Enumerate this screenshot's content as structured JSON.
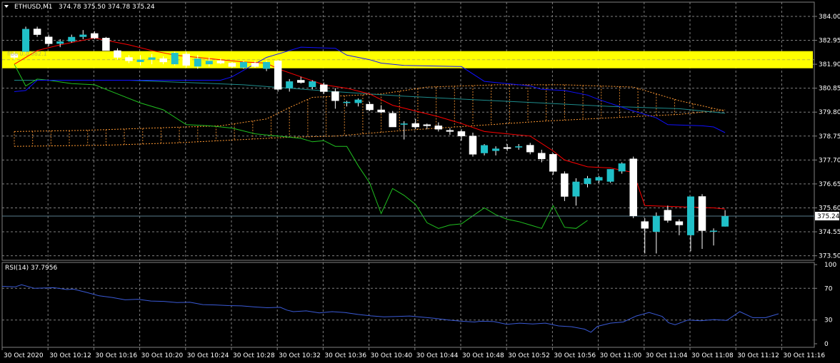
{
  "header": {
    "symbol": "ETHUSD,M1",
    "ohlc": "374.78 375.50 374.78 375.24"
  },
  "rsi_header": "RSI(14) 37.7956",
  "yellow_label": "fibo 0.0 382.1",
  "current_price_label": "375.24",
  "colors": {
    "background": "#000000",
    "grid": "#7f7f7f",
    "bull_candle": "#20c0c8",
    "bear_candle": "#ffffff",
    "fast_ma": "#ff0000",
    "kijun": "#1010ff",
    "senkou": "#ff9933",
    "chikou": "#20c020",
    "slow_ma": "#1e8c8c",
    "highlight": "#ffff00",
    "rsi_line": "#3a5ad6"
  },
  "chart_data": [
    {
      "type": "candlestick",
      "title": "ETHUSD,M1",
      "price_ticks": [
        "384.00",
        "382.95",
        "381.90",
        "380.85",
        "379.80",
        "378.75",
        "377.70",
        "376.65",
        "375.60",
        "374.55",
        "373.50"
      ],
      "time_ticks": [
        "30 Oct 2020",
        "30 Oct 10:12",
        "30 Oct 10:16",
        "30 Oct 10:20",
        "30 Oct 10:24",
        "30 Oct 10:28",
        "30 Oct 10:32",
        "30 Oct 10:36",
        "30 Oct 10:40",
        "30 Oct 10:44",
        "30 Oct 10:48",
        "30 Oct 10:52",
        "30 Oct 10:56",
        "30 Oct 11:00",
        "30 Oct 11:04",
        "30 Oct 11:08",
        "30 Oct 11:12",
        "30 Oct 11:16"
      ],
      "ylim": [
        373.3,
        384.5
      ],
      "grid": true,
      "last_price": 375.24,
      "highlight_level": 382.1,
      "candles": [
        [
          382.35,
          382.45,
          382.1,
          382.2
        ],
        [
          382.45,
          383.55,
          382.35,
          383.45
        ],
        [
          383.45,
          383.55,
          383.1,
          383.2
        ],
        [
          383.1,
          383.2,
          382.7,
          382.8
        ],
        [
          382.8,
          383.0,
          382.65,
          382.9
        ],
        [
          382.9,
          383.2,
          382.85,
          383.1
        ],
        [
          383.1,
          383.4,
          383.0,
          383.2
        ],
        [
          383.25,
          383.35,
          383.0,
          383.05
        ],
        [
          383.05,
          383.1,
          382.7,
          382.5
        ],
        [
          382.5,
          382.6,
          382.1,
          382.2
        ],
        [
          382.2,
          382.3,
          381.95,
          382.05
        ],
        [
          382.0,
          382.3,
          381.85,
          382.1
        ],
        [
          382.1,
          382.35,
          381.9,
          382.2
        ],
        [
          382.15,
          382.25,
          381.9,
          382.0
        ],
        [
          381.9,
          382.45,
          381.85,
          382.4
        ],
        [
          382.35,
          382.45,
          381.75,
          381.85
        ],
        [
          381.8,
          382.3,
          381.7,
          382.15
        ],
        [
          381.9,
          382.2,
          381.8,
          382.05
        ],
        [
          382.05,
          382.15,
          381.9,
          381.95
        ],
        [
          381.95,
          382.0,
          381.75,
          381.8
        ],
        [
          381.75,
          382.05,
          381.7,
          382.0
        ],
        [
          381.95,
          382.05,
          381.75,
          381.8
        ],
        [
          381.7,
          382.05,
          381.6,
          382.0
        ],
        [
          382.05,
          382.1,
          380.7,
          380.8
        ],
        [
          380.85,
          381.25,
          380.7,
          381.15
        ],
        [
          381.2,
          381.35,
          381.05,
          381.1
        ],
        [
          380.9,
          381.2,
          380.8,
          381.15
        ],
        [
          381.0,
          381.1,
          380.6,
          380.7
        ],
        [
          380.7,
          380.85,
          379.95,
          380.3
        ],
        [
          380.2,
          380.3,
          380.05,
          380.25
        ],
        [
          380.2,
          380.4,
          380.05,
          380.35
        ],
        [
          380.15,
          380.25,
          379.85,
          379.9
        ],
        [
          379.9,
          380.1,
          379.75,
          379.8
        ],
        [
          379.75,
          379.85,
          379.15,
          379.15
        ],
        [
          379.25,
          379.4,
          378.6,
          379.3
        ],
        [
          379.3,
          379.5,
          379.05,
          379.15
        ],
        [
          379.25,
          379.3,
          379.05,
          379.2
        ],
        [
          379.2,
          379.35,
          378.95,
          379.05
        ],
        [
          379.0,
          379.1,
          378.8,
          378.95
        ],
        [
          378.95,
          379.05,
          378.55,
          378.75
        ],
        [
          378.75,
          378.9,
          377.85,
          377.95
        ],
        [
          378.0,
          378.4,
          377.9,
          378.35
        ],
        [
          378.1,
          378.3,
          377.9,
          378.2
        ],
        [
          378.25,
          378.4,
          378.1,
          378.2
        ],
        [
          378.25,
          378.4,
          378.15,
          378.3
        ],
        [
          378.35,
          378.45,
          377.95,
          378.05
        ],
        [
          378.0,
          378.15,
          377.6,
          377.75
        ],
        [
          377.95,
          378.0,
          377.05,
          377.2
        ],
        [
          377.1,
          377.2,
          375.9,
          376.1
        ],
        [
          376.1,
          376.9,
          375.7,
          376.75
        ],
        [
          376.65,
          377.0,
          376.5,
          376.9
        ],
        [
          376.8,
          377.0,
          376.7,
          376.95
        ],
        [
          376.75,
          377.3,
          376.7,
          377.3
        ],
        [
          377.2,
          377.6,
          377.1,
          377.55
        ],
        [
          377.75,
          377.85,
          375.15,
          375.25
        ],
        [
          375.0,
          375.15,
          373.6,
          374.7
        ],
        [
          374.55,
          375.4,
          373.6,
          375.25
        ],
        [
          375.5,
          375.7,
          374.95,
          375.05
        ],
        [
          375.0,
          375.1,
          374.4,
          374.85
        ],
        [
          374.4,
          376.1,
          373.7,
          376.1
        ],
        [
          376.1,
          376.2,
          373.8,
          374.6
        ],
        [
          374.6,
          374.7,
          373.95,
          374.6
        ],
        [
          374.78,
          375.5,
          374.78,
          375.24
        ]
      ],
      "fast_ma": [
        [
          0,
          381.9
        ],
        [
          2,
          382.5
        ],
        [
          4,
          382.75
        ],
        [
          7,
          383.05
        ],
        [
          10,
          382.75
        ],
        [
          12,
          382.5
        ],
        [
          14,
          382.3
        ],
        [
          16,
          382.2
        ],
        [
          18,
          382.1
        ],
        [
          20,
          382.0
        ],
        [
          22,
          381.95
        ],
        [
          23,
          381.7
        ],
        [
          25,
          381.35
        ],
        [
          27,
          381.0
        ],
        [
          29,
          380.85
        ],
        [
          31,
          380.6
        ],
        [
          33,
          380.1
        ],
        [
          35,
          379.85
        ],
        [
          37,
          379.6
        ],
        [
          39,
          379.3
        ],
        [
          41,
          378.95
        ],
        [
          43,
          378.85
        ],
        [
          45,
          378.75
        ],
        [
          47,
          378.1
        ],
        [
          48,
          377.7
        ],
        [
          50,
          377.4
        ],
        [
          52,
          377.35
        ],
        [
          54,
          377.15
        ],
        [
          55,
          375.7
        ],
        [
          58,
          375.65
        ],
        [
          61,
          375.6
        ],
        [
          62,
          375.55
        ]
      ],
      "kijun": [
        [
          0,
          380.7
        ],
        [
          1,
          380.75
        ],
        [
          2,
          381.2
        ],
        [
          5,
          381.2
        ],
        [
          18,
          381.2
        ],
        [
          19,
          381.35
        ],
        [
          22,
          382.2
        ],
        [
          25,
          382.65
        ],
        [
          28,
          382.6
        ],
        [
          29,
          382.3
        ],
        [
          31,
          382.1
        ],
        [
          32,
          381.95
        ],
        [
          34,
          381.85
        ],
        [
          39,
          381.8
        ],
        [
          41,
          381.15
        ],
        [
          43,
          381.05
        ],
        [
          45,
          380.95
        ],
        [
          46,
          380.8
        ],
        [
          48,
          380.75
        ],
        [
          50,
          380.55
        ],
        [
          51,
          380.35
        ],
        [
          54,
          379.85
        ],
        [
          56,
          379.55
        ],
        [
          57,
          379.25
        ],
        [
          60,
          379.2
        ],
        [
          61,
          379.15
        ],
        [
          62,
          378.9
        ]
      ],
      "chikou": [
        [
          0,
          381.9
        ],
        [
          1,
          380.95
        ],
        [
          2,
          381.25
        ],
        [
          3,
          381.2
        ],
        [
          5,
          381.05
        ],
        [
          7,
          381.0
        ],
        [
          9,
          380.6
        ],
        [
          11,
          380.2
        ],
        [
          13,
          379.9
        ],
        [
          15,
          379.25
        ],
        [
          17,
          379.2
        ],
        [
          19,
          379.1
        ],
        [
          21,
          378.85
        ],
        [
          23,
          378.75
        ],
        [
          25,
          378.65
        ],
        [
          26,
          378.5
        ],
        [
          27,
          378.55
        ],
        [
          28,
          378.3
        ],
        [
          29,
          378.3
        ],
        [
          30,
          377.45
        ],
        [
          31,
          376.7
        ],
        [
          32,
          375.35
        ],
        [
          33,
          376.45
        ],
        [
          34,
          376.15
        ],
        [
          35,
          375.75
        ],
        [
          36,
          374.95
        ],
        [
          37,
          374.7
        ],
        [
          38,
          374.85
        ],
        [
          39,
          374.9
        ],
        [
          40,
          375.25
        ],
        [
          41,
          375.6
        ],
        [
          42,
          375.3
        ],
        [
          43,
          375.1
        ],
        [
          44,
          375.0
        ],
        [
          45,
          374.85
        ],
        [
          46,
          374.7
        ],
        [
          47,
          375.7
        ],
        [
          48,
          374.75
        ],
        [
          49,
          374.7
        ],
        [
          50,
          375.05
        ]
      ],
      "slow_ma": [
        [
          0,
          381.2
        ],
        [
          10,
          381.2
        ],
        [
          20,
          381.0
        ],
        [
          28,
          380.7
        ],
        [
          34,
          380.5
        ],
        [
          40,
          380.35
        ],
        [
          46,
          380.2
        ],
        [
          52,
          380.05
        ],
        [
          58,
          379.95
        ],
        [
          62,
          379.75
        ]
      ],
      "senkou_a": [
        [
          0,
          378.95
        ],
        [
          6,
          379.0
        ],
        [
          12,
          379.1
        ],
        [
          18,
          379.2
        ],
        [
          22,
          379.5
        ],
        [
          24,
          380.0
        ],
        [
          26,
          380.45
        ],
        [
          28,
          380.5
        ],
        [
          32,
          380.6
        ],
        [
          36,
          380.9
        ],
        [
          42,
          381.0
        ],
        [
          48,
          381.0
        ],
        [
          54,
          380.9
        ],
        [
          58,
          380.3
        ],
        [
          62,
          379.85
        ]
      ],
      "senkou_b": [
        [
          0,
          378.3
        ],
        [
          8,
          378.35
        ],
        [
          14,
          378.45
        ],
        [
          20,
          378.6
        ],
        [
          24,
          378.7
        ],
        [
          28,
          378.75
        ],
        [
          34,
          379.0
        ],
        [
          40,
          379.2
        ],
        [
          46,
          379.4
        ],
        [
          52,
          379.55
        ],
        [
          58,
          379.7
        ],
        [
          62,
          379.9
        ]
      ]
    },
    {
      "type": "line",
      "title": "RSI(14) 37.7956",
      "ylim": [
        0,
        100
      ],
      "ticks": [
        "100",
        "70",
        "30",
        "0"
      ],
      "levels": [
        70,
        30
      ],
      "rsi": [
        [
          0,
          72.5
        ],
        [
          2,
          71.8
        ],
        [
          3,
          74.5
        ],
        [
          5,
          70.0
        ],
        [
          8,
          70.8
        ],
        [
          10,
          68.5
        ],
        [
          11,
          69.0
        ],
        [
          13,
          65.0
        ],
        [
          15,
          60.5
        ],
        [
          17,
          58.5
        ],
        [
          19,
          55.5
        ],
        [
          21,
          56.2
        ],
        [
          23,
          54.0
        ],
        [
          25,
          53.5
        ],
        [
          27,
          52.0
        ],
        [
          29,
          52.5
        ],
        [
          31,
          49.5
        ],
        [
          33,
          49.0
        ],
        [
          35,
          48.2
        ],
        [
          37,
          47.8
        ],
        [
          39,
          46.5
        ],
        [
          41,
          45.5
        ],
        [
          43,
          46.0
        ],
        [
          44,
          42.5
        ],
        [
          45,
          40.5
        ],
        [
          47,
          41.5
        ],
        [
          49,
          39.0
        ],
        [
          51,
          40.5
        ],
        [
          53,
          39.5
        ],
        [
          55,
          37.0
        ],
        [
          57,
          35.2
        ],
        [
          59,
          34.0
        ],
        [
          61,
          34.5
        ],
        [
          63,
          35.0
        ],
        [
          65,
          33.5
        ],
        [
          67,
          32.0
        ],
        [
          69,
          30.0
        ],
        [
          71,
          28.5
        ],
        [
          73,
          27.5
        ],
        [
          74,
          28.5
        ],
        [
          76,
          28.0
        ],
        [
          78,
          24.5
        ],
        [
          80,
          26.0
        ],
        [
          82,
          25.0
        ],
        [
          84,
          26.0
        ],
        [
          86,
          22.5
        ],
        [
          88,
          21.5
        ],
        [
          90,
          18.5
        ],
        [
          91,
          14.5
        ],
        [
          92,
          22.0
        ],
        [
          94,
          26.0
        ],
        [
          96,
          27.5
        ],
        [
          98,
          35.0
        ],
        [
          100,
          39.5
        ],
        [
          102,
          34.5
        ],
        [
          103,
          26.5
        ],
        [
          104,
          24.0
        ],
        [
          106,
          30.0
        ],
        [
          108,
          29.0
        ],
        [
          110,
          30.5
        ],
        [
          112,
          29.5
        ],
        [
          114,
          40.5
        ],
        [
          116,
          33.0
        ],
        [
          118,
          33.0
        ],
        [
          120,
          37.8
        ]
      ]
    }
  ]
}
